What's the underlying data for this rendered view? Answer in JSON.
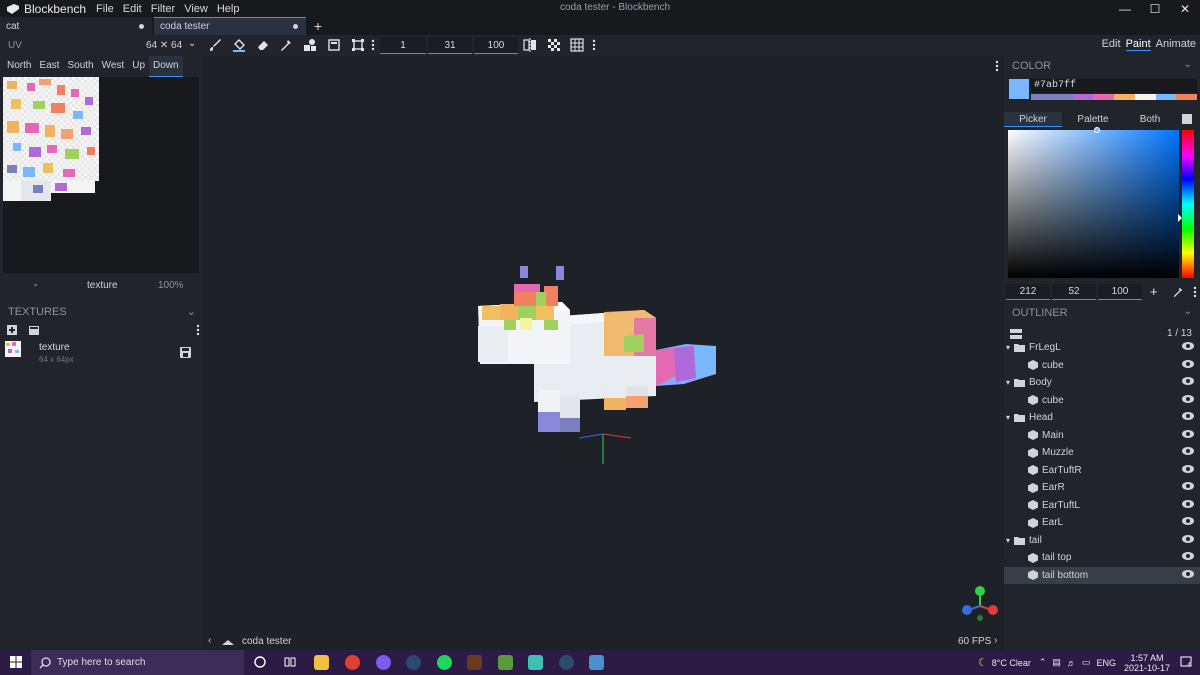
{
  "app": {
    "name": "Blockbench",
    "window_title": "coda tester - Blockbench",
    "menu": [
      "File",
      "Edit",
      "Filter",
      "View",
      "Help"
    ]
  },
  "tabs": [
    {
      "label": "cat"
    },
    {
      "label": "coda tester"
    }
  ],
  "uv_panel": {
    "label": "UV",
    "size": "64 ✕ 64",
    "faces": [
      "North",
      "East",
      "South",
      "West",
      "Up",
      "Down"
    ],
    "active_face": "Down",
    "footer_dash": "-",
    "footer_texture": "texture",
    "footer_zoom": "100%"
  },
  "toolbar": {
    "brush_size": "1",
    "opacity": "31",
    "softness": "100"
  },
  "modes": [
    "Edit",
    "Paint",
    "Animate"
  ],
  "active_mode": "Paint",
  "textures_panel": {
    "header": "TEXTURES",
    "items": [
      {
        "name": "texture",
        "size": "64 x 64px"
      }
    ]
  },
  "color_panel": {
    "header": "COLOR",
    "hex": "#7ab7ff",
    "swatch": "#7ab7ff",
    "palette": [
      "#7a7fc0",
      "#b06ad8",
      "#e468b4",
      "#f0b460",
      "#f4f4f4",
      "#7ab7ff",
      "#f08060"
    ],
    "picker_tabs": [
      "Picker",
      "Palette",
      "Both"
    ],
    "active_picker_tab": "Picker",
    "hsv": {
      "h": "212",
      "s": "52",
      "v": "100"
    }
  },
  "outliner": {
    "header": "OUTLINER",
    "count": "1 / 13",
    "rows": [
      {
        "type": "group",
        "label": "FrLegL"
      },
      {
        "type": "cube",
        "label": "cube"
      },
      {
        "type": "group",
        "label": "Body"
      },
      {
        "type": "cube",
        "label": "cube"
      },
      {
        "type": "group",
        "label": "Head"
      },
      {
        "type": "cube",
        "label": "Main"
      },
      {
        "type": "cube",
        "label": "Muzzle"
      },
      {
        "type": "cube",
        "label": "EarTuftR"
      },
      {
        "type": "cube",
        "label": "EarR"
      },
      {
        "type": "cube",
        "label": "EarTuftL"
      },
      {
        "type": "cube",
        "label": "EarL"
      },
      {
        "type": "group",
        "label": "tail"
      },
      {
        "type": "cube",
        "label": "tail top"
      },
      {
        "type": "cube",
        "label": "tail bottom",
        "selected": true
      }
    ]
  },
  "viewport": {
    "footer_model": "coda tester",
    "fps": "60 FPS"
  },
  "taskbar": {
    "search_placeholder": "Type here to search",
    "weather": "8°C  Clear",
    "lang": "ENG",
    "time": "1:57 AM",
    "date": "2021-10-17",
    "notifications": "4"
  }
}
